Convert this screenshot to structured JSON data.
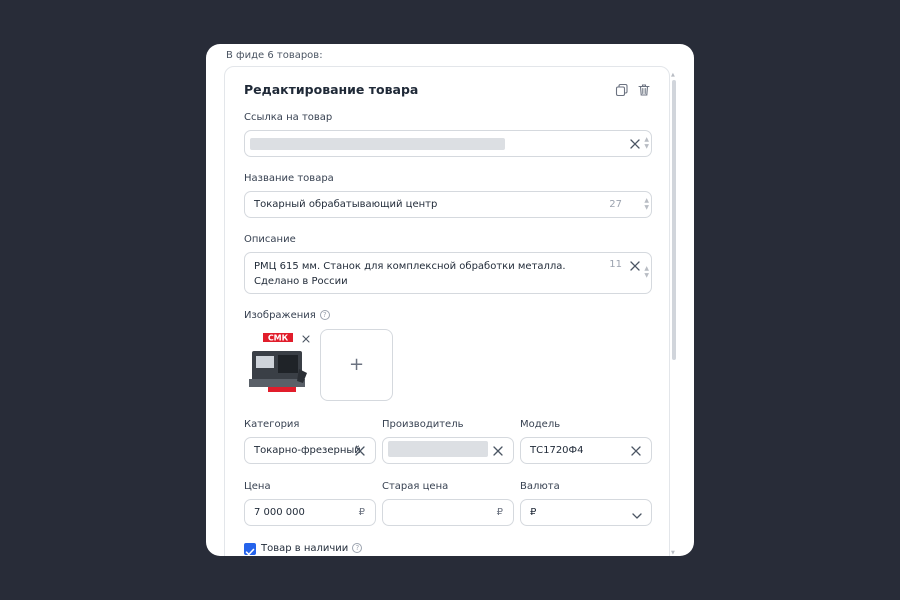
{
  "feed": {
    "count_text": "В фиде 6 товаров:"
  },
  "editor": {
    "title": "Редактирование товара",
    "link": {
      "label": "Ссылка на товар",
      "value": ""
    },
    "name": {
      "label": "Название товара",
      "value": "Токарный обрабатывающий центр",
      "counter": "27"
    },
    "description": {
      "label": "Описание",
      "value": "РМЦ 615 мм. Станок для комплексной обработки металла. Сделано в России",
      "counter": "11"
    },
    "images": {
      "label": "Изображения",
      "help": "?",
      "add_symbol": "+",
      "thumb_logo_text": "СМК"
    },
    "category": {
      "label": "Категория",
      "value": "Токарно-фрезерный"
    },
    "manufacturer": {
      "label": "Производитель",
      "value": ""
    },
    "model": {
      "label": "Модель",
      "value": "ТС1720Ф4"
    },
    "price": {
      "label": "Цена",
      "value": "7 000 000",
      "currency": "₽"
    },
    "old_price": {
      "label": "Старая цена",
      "value": "",
      "currency": "₽"
    },
    "currency": {
      "label": "Валюта",
      "value": "₽"
    },
    "in_stock": {
      "label": "Товар в наличии",
      "checked": true,
      "help": "?"
    }
  },
  "icons": {
    "copy": "copy-icon",
    "delete": "trash-icon",
    "clear": "close-icon",
    "chevron": "chevron-down-icon",
    "help": "question-circle-icon",
    "check": "check-icon"
  },
  "colors": {
    "background": "#282c38",
    "accent": "#2563eb",
    "logo_red": "#e11d2b"
  }
}
